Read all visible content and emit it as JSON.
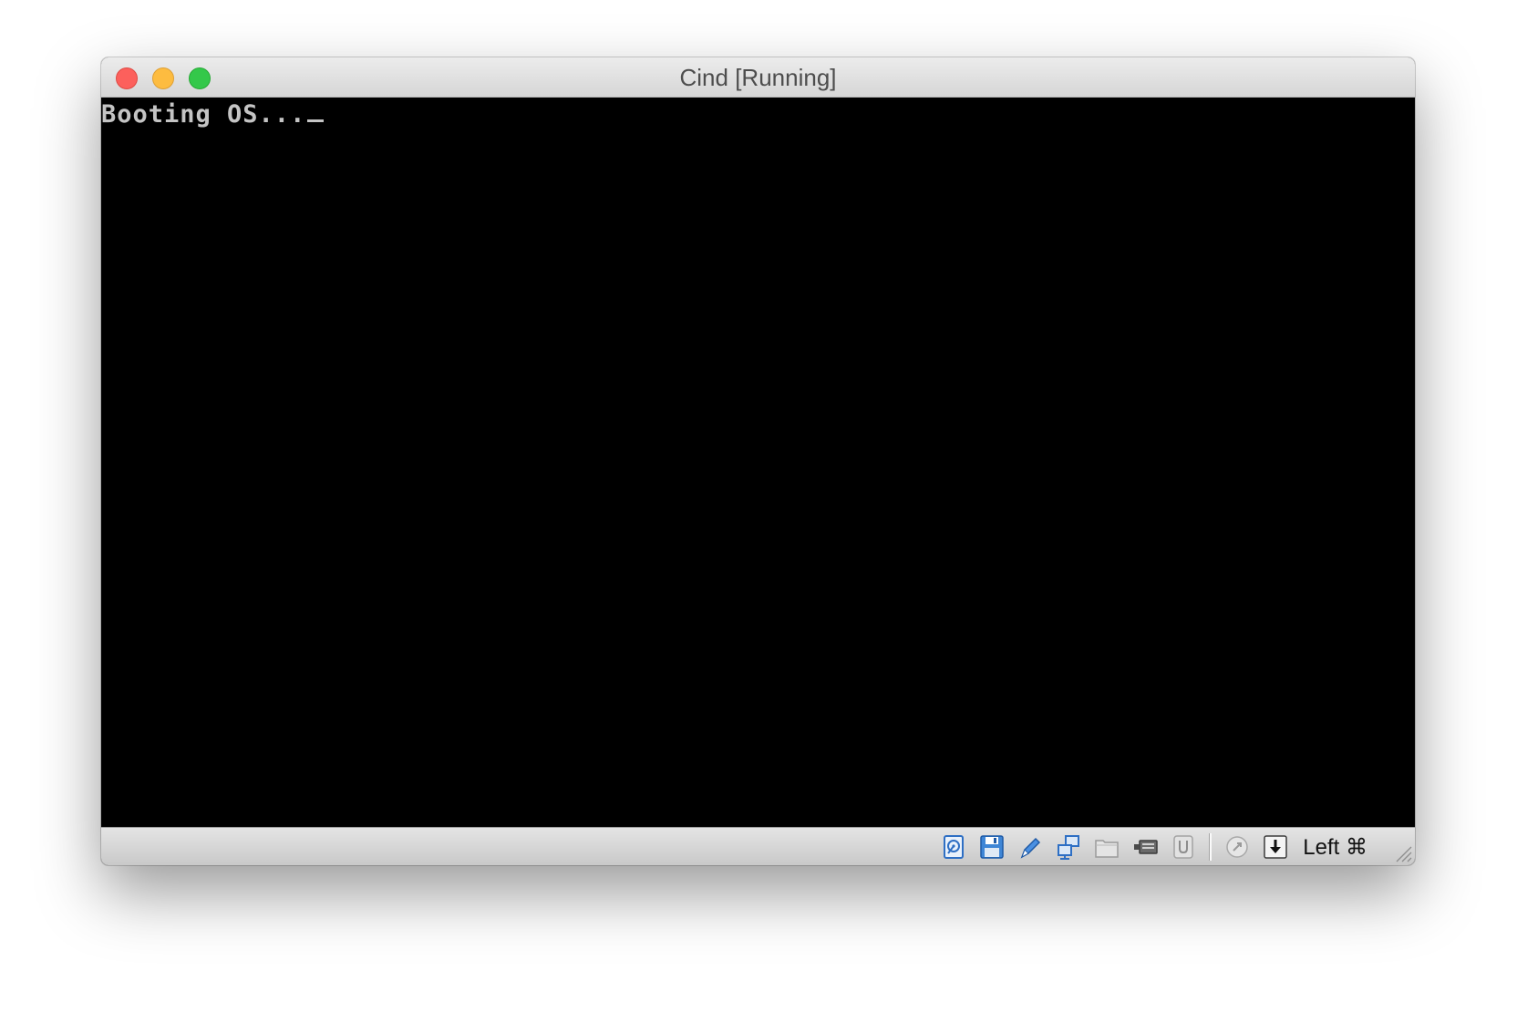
{
  "window": {
    "title": "Cind [Running]"
  },
  "console": {
    "text": "Booting OS...",
    "text_color": "#c4c4c4",
    "background": "#000000"
  },
  "statusbar": {
    "icons": [
      "hard-disk-icon",
      "floppy-disk-icon",
      "optical-drive-icon",
      "network-icon",
      "shared-folders-icon",
      "video-capture-icon",
      "usb-icon",
      "mouse-integration-icon",
      "keyboard-capture-icon"
    ],
    "host_key": "Left ⌘"
  }
}
